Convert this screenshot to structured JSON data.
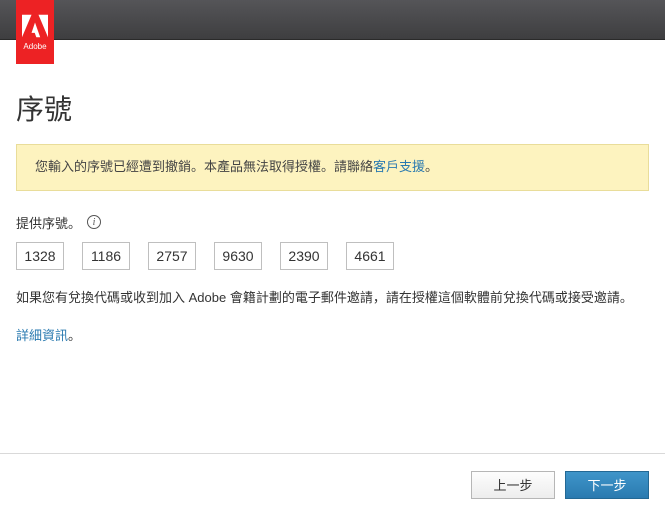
{
  "brand": {
    "name": "Adobe"
  },
  "heading": "序號",
  "alert": {
    "text_before": "您輸入的序號已經遭到撤銷。本產品無法取得授權。請聯絡",
    "link_text": "客戶支援",
    "text_after": "。"
  },
  "serial": {
    "prompt": "提供序號。",
    "values": [
      "1328",
      "1186",
      "2757",
      "9630",
      "2390",
      "4661"
    ]
  },
  "redeem_text": "如果您有兌換代碼或收到加入 Adobe 會籍計劃的電子郵件邀請，請在授權這個軟體前兌換代碼或接受邀請。",
  "more_info": {
    "link_text": "詳細資訊",
    "suffix": "。"
  },
  "footer": {
    "back_label": "上一步",
    "next_label": "下一步"
  }
}
